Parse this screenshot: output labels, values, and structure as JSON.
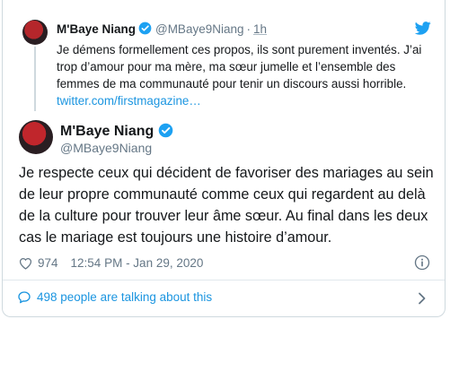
{
  "quoted": {
    "name": "M'Baye Niang",
    "handle": "@MBaye9Niang",
    "separator": "·",
    "time": "1h",
    "text": "Je démens formellement ces propos, ils sont purement inventés. J’ai trop d’amour pour ma mère, ma sœur jumelle et l’ensemble des femmes de ma communauté pour tenir un discours aussi horrible.",
    "link": "twitter.com/firstmagazine…"
  },
  "tweet": {
    "name": "M'Baye Niang",
    "handle": "@MBaye9Niang",
    "text": "Je respecte ceux qui décident de favoriser des mariages au sein de leur propre communauté comme ceux qui regardent au delà de la culture pour trouver leur âme sœur. Au final dans les deux cas le mariage est toujours une histoire d’amour.",
    "likes": "974",
    "timestamp": "12:54 PM - Jan 29, 2020"
  },
  "footer": {
    "talking": "498 people are talking about this"
  },
  "colors": {
    "accent": "#1b95e0",
    "verified": "#1da1f2",
    "muted": "#657786"
  },
  "icons": [
    "twitter-bird-icon",
    "verified-icon",
    "heart-icon",
    "info-icon",
    "comment-icon",
    "chevron-right-icon"
  ]
}
